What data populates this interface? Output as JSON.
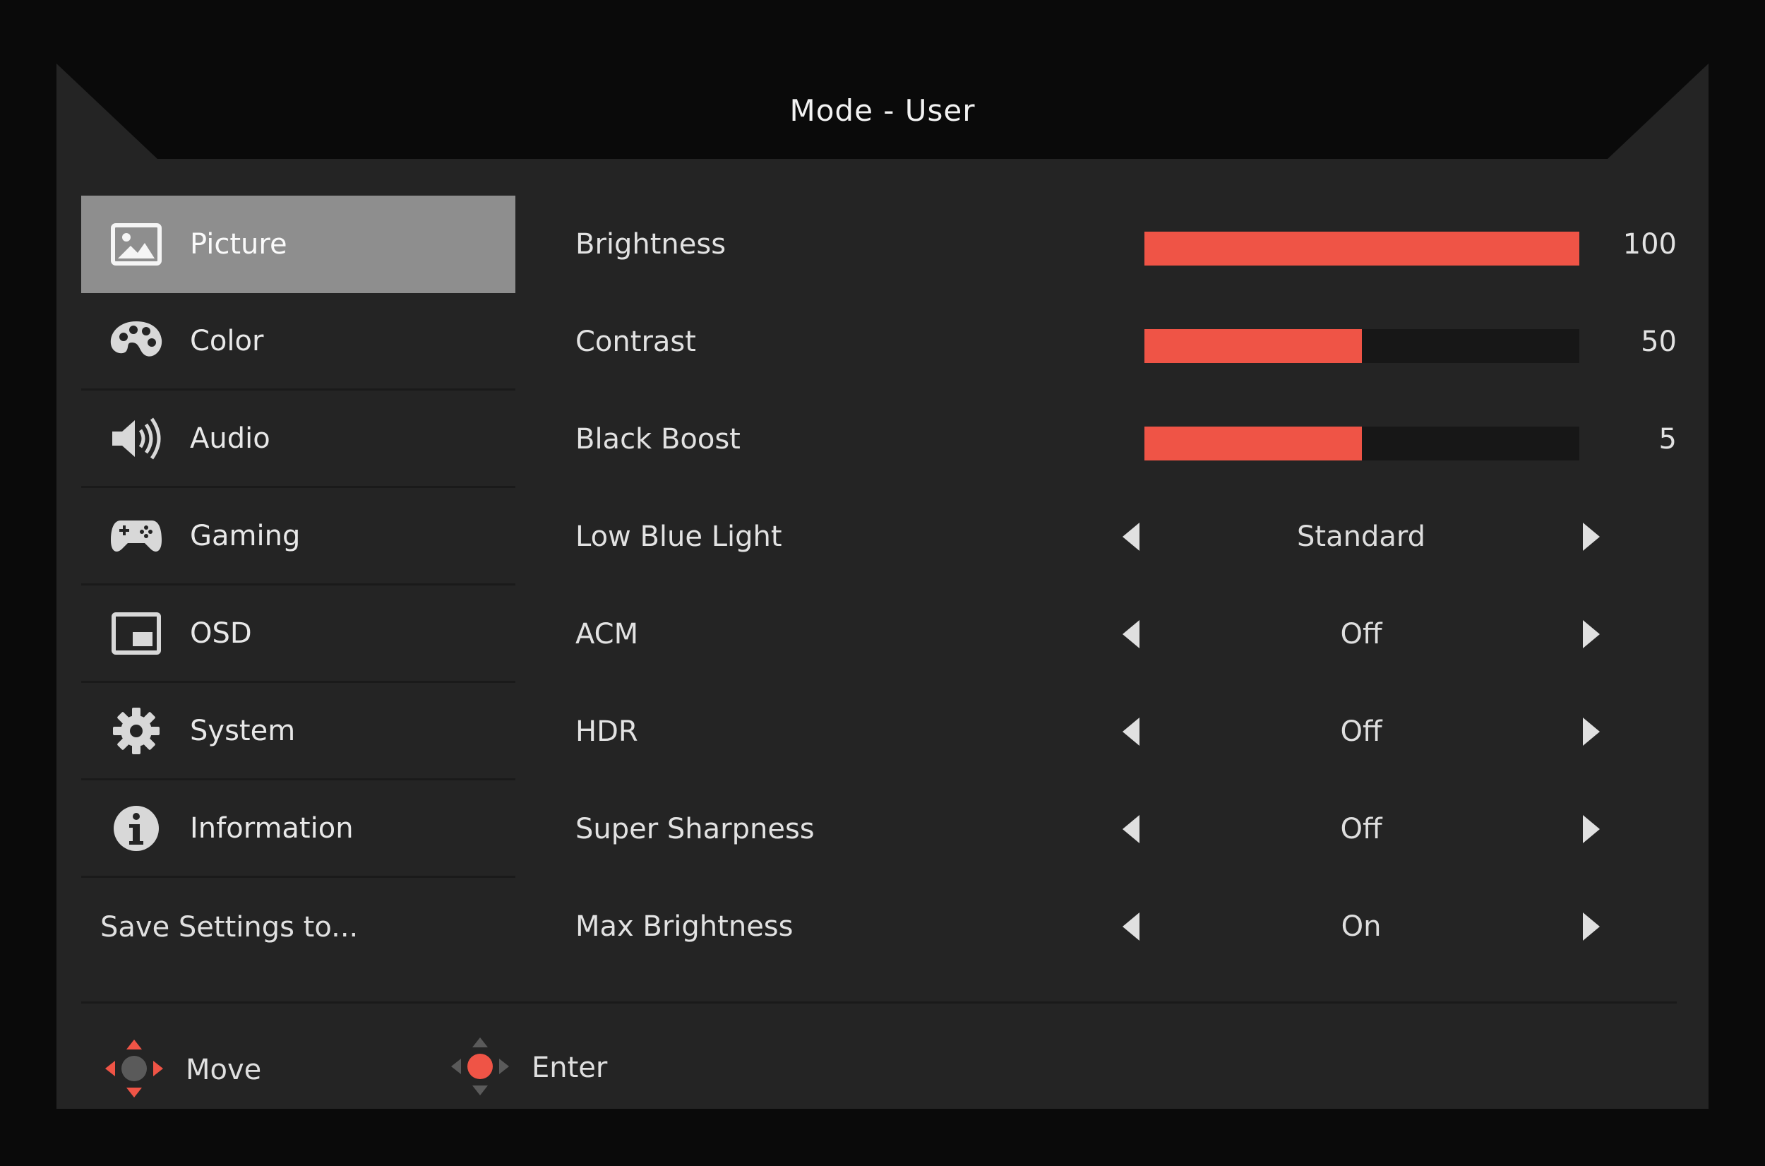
{
  "header": {
    "title": "Mode - User"
  },
  "sidebar": {
    "items": [
      {
        "label": "Picture",
        "icon": "picture-icon",
        "active": true
      },
      {
        "label": "Color",
        "icon": "palette-icon"
      },
      {
        "label": "Audio",
        "icon": "speaker-icon"
      },
      {
        "label": "Gaming",
        "icon": "gamepad-icon"
      },
      {
        "label": "OSD",
        "icon": "osd-window-icon"
      },
      {
        "label": "System",
        "icon": "gear-icon"
      },
      {
        "label": "Information",
        "icon": "info-icon"
      }
    ],
    "save_label": "Save Settings to..."
  },
  "settings": {
    "sliders": [
      {
        "label": "Brightness",
        "value": "100",
        "level": 100
      },
      {
        "label": "Contrast",
        "value": "50",
        "level": 50
      },
      {
        "label": "Black Boost",
        "value": "5",
        "level": 50
      }
    ],
    "options": [
      {
        "label": "Low Blue Light",
        "value": "Standard"
      },
      {
        "label": "ACM",
        "value": "Off"
      },
      {
        "label": "HDR",
        "value": "Off"
      },
      {
        "label": "Super Sharpness",
        "value": "Off"
      },
      {
        "label": "Max Brightness",
        "value": "On"
      }
    ]
  },
  "footer": {
    "move_label": "Move",
    "enter_label": "Enter"
  },
  "colors": {
    "accent": "#ef5446",
    "panel": "#242424",
    "active_item": "#8e8e8e"
  }
}
